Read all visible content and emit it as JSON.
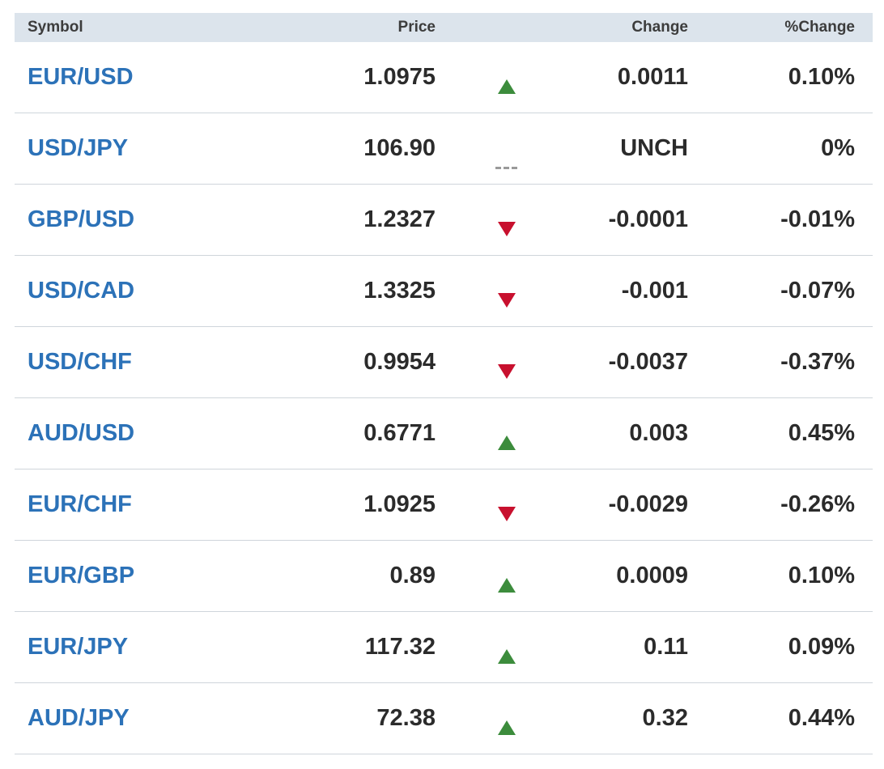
{
  "table": {
    "headers": {
      "symbol": "Symbol",
      "price": "Price",
      "change": "Change",
      "pct_change": "%Change"
    },
    "colors": {
      "up": "#3c8c3c",
      "down": "#c8102e",
      "flat": "#9a9a9a",
      "link": "#2c72b8",
      "header_bg": "#dce4ec"
    },
    "rows": [
      {
        "symbol": "EUR/USD",
        "price": "1.0975",
        "direction": "up",
        "icon": "triangle-up-icon",
        "change": "0.0011",
        "pct_change": "0.10%"
      },
      {
        "symbol": "USD/JPY",
        "price": "106.90",
        "direction": "flat",
        "icon": "dash-icon",
        "change": "UNCH",
        "pct_change": "0%"
      },
      {
        "symbol": "GBP/USD",
        "price": "1.2327",
        "direction": "down",
        "icon": "triangle-down-icon",
        "change": "-0.0001",
        "pct_change": "-0.01%"
      },
      {
        "symbol": "USD/CAD",
        "price": "1.3325",
        "direction": "down",
        "icon": "triangle-down-icon",
        "change": "-0.001",
        "pct_change": "-0.07%"
      },
      {
        "symbol": "USD/CHF",
        "price": "0.9954",
        "direction": "down",
        "icon": "triangle-down-icon",
        "change": "-0.0037",
        "pct_change": "-0.37%"
      },
      {
        "symbol": "AUD/USD",
        "price": "0.6771",
        "direction": "up",
        "icon": "triangle-up-icon",
        "change": "0.003",
        "pct_change": "0.45%"
      },
      {
        "symbol": "EUR/CHF",
        "price": "1.0925",
        "direction": "down",
        "icon": "triangle-down-icon",
        "change": "-0.0029",
        "pct_change": "-0.26%"
      },
      {
        "symbol": "EUR/GBP",
        "price": "0.89",
        "direction": "up",
        "icon": "triangle-up-icon",
        "change": "0.0009",
        "pct_change": "0.10%"
      },
      {
        "symbol": "EUR/JPY",
        "price": "117.32",
        "direction": "up",
        "icon": "triangle-up-icon",
        "change": "0.11",
        "pct_change": "0.09%"
      },
      {
        "symbol": "AUD/JPY",
        "price": "72.38",
        "direction": "up",
        "icon": "triangle-up-icon",
        "change": "0.32",
        "pct_change": "0.44%"
      }
    ]
  }
}
